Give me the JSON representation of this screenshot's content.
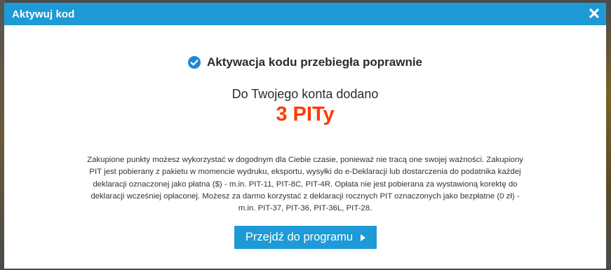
{
  "dialog": {
    "title": "Aktywuj kod",
    "close_icon": "close-icon"
  },
  "main": {
    "success_icon": "check-circle-icon",
    "success_message": "Aktywacja kodu przebiegła poprawnie",
    "added_label": "Do Twojego konta dodano",
    "pit_count": "3 PITy",
    "info_paragraph": "Zakupione punkty możesz wykorzystać w dogodnym dla Ciebie czasie, ponieważ nie tracą one swojej ważności. Zakupiony PIT jest pobierany z pakietu w momencie wydruku, eksportu, wysyłki do e-Deklaracji lub dostarczenia do podatnika każdej deklaracji oznaczonej jako płatna ($) - m.in. PIT-11, PIT-8C, PIT-4R. Opłata nie jest pobierana za wystawioną korektę do deklaracji wcześniej opłaconej. Możesz za darmo korzystać z deklaracji rocznych PIT oznaczonych jako bezpłatne (0 zł) - m.in. PIT-37, PIT-36, PIT-36L, PIT-28.",
    "cta_label": "Przejdź do programu",
    "cta_icon": "play-triangle-icon"
  },
  "colors": {
    "accent": "#1e9ad6",
    "highlight": "#ff3a00",
    "text": "#2b2b2b"
  }
}
